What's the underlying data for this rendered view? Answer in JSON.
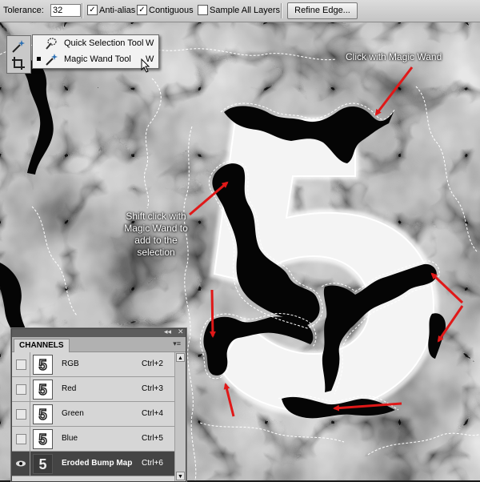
{
  "options_bar": {
    "tolerance_label": "Tolerance:",
    "tolerance_value": "32",
    "anti_alias_label": "Anti-alias",
    "anti_alias_checked": true,
    "contiguous_label": "Contiguous",
    "contiguous_checked": true,
    "sample_all_layers_label": "Sample All Layers",
    "sample_all_layers_checked": false,
    "refine_edge_label": "Refine Edge..."
  },
  "tool_flyout": {
    "items": [
      {
        "label": "Quick Selection Tool",
        "shortcut": "W",
        "icon": "quick-selection-icon",
        "active": false
      },
      {
        "label": "Magic Wand Tool",
        "shortcut": "W",
        "icon": "magic-wand-icon",
        "active": true
      }
    ]
  },
  "annotations": {
    "click_note": "Click with Magic Wand",
    "shift_note_lines": [
      "Shift click with",
      "Magic Wand to",
      "add to the",
      "selection"
    ]
  },
  "channels_panel": {
    "tab_label": "CHANNELS",
    "thumb_glyph": "5",
    "channels": [
      {
        "name": "RGB",
        "shortcut": "Ctrl+2",
        "visible": false,
        "selected": false
      },
      {
        "name": "Red",
        "shortcut": "Ctrl+3",
        "visible": false,
        "selected": false
      },
      {
        "name": "Green",
        "shortcut": "Ctrl+4",
        "visible": false,
        "selected": false
      },
      {
        "name": "Blue",
        "shortcut": "Ctrl+5",
        "visible": false,
        "selected": false
      },
      {
        "name": "Eroded Bump Map",
        "shortcut": "Ctrl+6",
        "visible": true,
        "selected": true
      }
    ]
  },
  "colors": {
    "annotation_arrow": "#e01818",
    "selected_row": "#444444"
  }
}
